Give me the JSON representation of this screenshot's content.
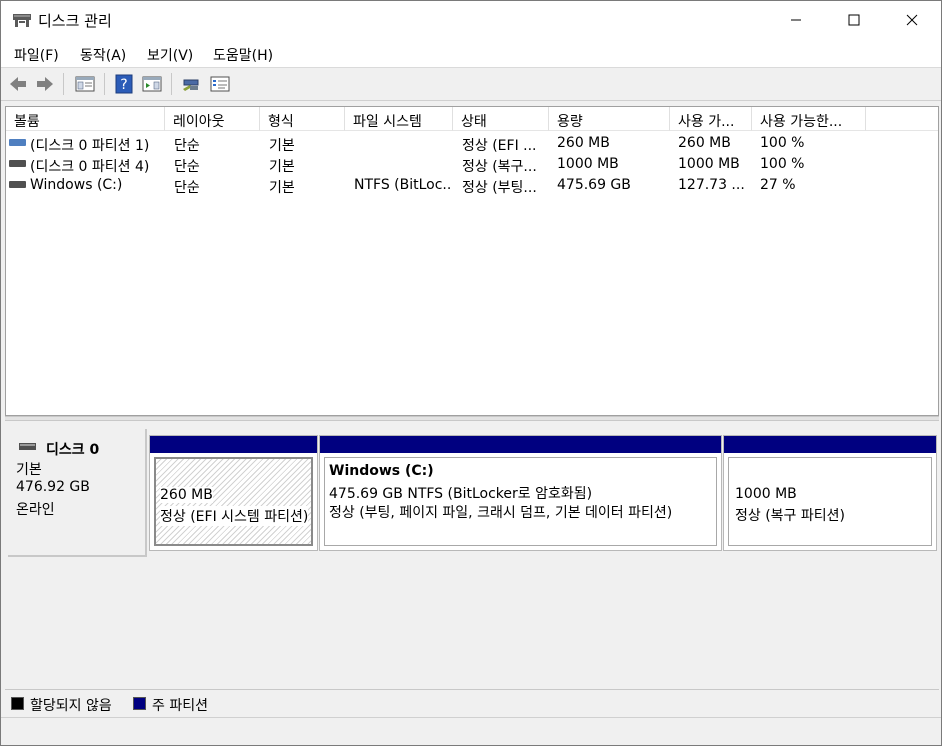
{
  "window": {
    "title": "디스크 관리",
    "minimize_glyph": "—",
    "maximize_glyph": "☐",
    "close_glyph": "✕"
  },
  "menu": [
    {
      "label": "파일(F)"
    },
    {
      "label": "동작(A)"
    },
    {
      "label": "보기(V)"
    },
    {
      "label": "도움말(H)"
    }
  ],
  "toolbar": {
    "icons": [
      "back-icon",
      "forward-icon",
      "console-tree-icon",
      "help-icon",
      "action-pane-icon",
      "connect-disk-icon",
      "properties-icon"
    ],
    "help_glyph": "?"
  },
  "volume_table": {
    "columns": [
      "볼륨",
      "레이아웃",
      "형식",
      "파일 시스템",
      "상태",
      "용량",
      "사용 가...",
      "사용 가능한..."
    ],
    "rows": [
      [
        "(디스크 0 파티션 1)",
        "단순",
        "기본",
        "",
        "정상 (EFI ...",
        "260 MB",
        "260 MB",
        "100 %"
      ],
      [
        "(디스크 0 파티션 4)",
        "단순",
        "기본",
        "",
        "정상 (복구...",
        "1000 MB",
        "1000 MB",
        "100 %"
      ],
      [
        "Windows (C:)",
        "단순",
        "기본",
        "NTFS (BitLoc...",
        "정상 (부팅...",
        "475.69 GB",
        "127.73 ...",
        "27 %"
      ]
    ]
  },
  "disk": {
    "name": "디스크 0",
    "type": "기본",
    "size": "476.92 GB",
    "status": "온라인",
    "partitions": [
      {
        "title": "",
        "size": "260 MB",
        "status": "정상 (EFI 시스템 파티션)"
      },
      {
        "title": "Windows  (C:)",
        "size": "475.69 GB NTFS (BitLocker로 암호화됨)",
        "status": "정상 (부팅, 페이지 파일, 크래시 덤프, 기본 데이터 파티션)"
      },
      {
        "title": "",
        "size": "1000 MB",
        "status": "정상 (복구 파티션)"
      }
    ]
  },
  "legend": [
    {
      "label": "할당되지 않음",
      "color": "#000000"
    },
    {
      "label": "주 파티션",
      "color": "#000080"
    }
  ],
  "colors": {
    "primary_partition": "#000080",
    "unallocated": "#000000"
  }
}
